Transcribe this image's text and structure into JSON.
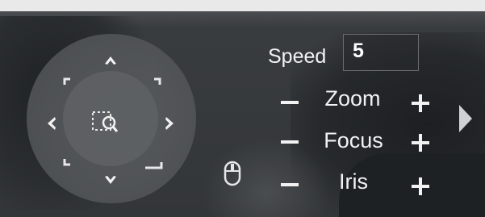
{
  "ptz": {
    "directions": [
      "up",
      "down",
      "left",
      "right",
      "up-left",
      "up-right",
      "down-left",
      "down-right"
    ],
    "center_icon": "zoom-to-area-icon"
  },
  "speed": {
    "label": "Speed",
    "value": "5"
  },
  "zoom": {
    "label": "Zoom",
    "minus_icon": "minus-icon",
    "plus_icon": "plus-icon"
  },
  "focus": {
    "label": "Focus",
    "minus_icon": "minus-icon",
    "plus_icon": "plus-icon"
  },
  "iris": {
    "label": "Iris",
    "minus_icon": "minus-icon",
    "plus_icon": "plus-icon"
  },
  "icons": {
    "mouse": "mouse-icon",
    "expand": "chevron-right-icon"
  },
  "colors": {
    "text": "#f2f2f2",
    "joystick": "#55585b"
  }
}
